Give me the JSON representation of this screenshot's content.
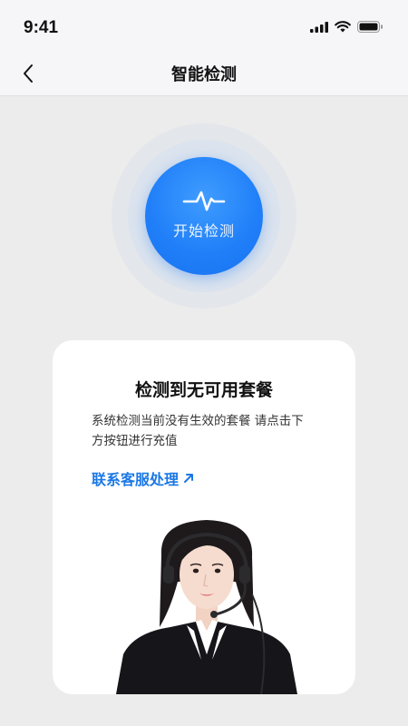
{
  "status_bar": {
    "time": "9:41"
  },
  "nav": {
    "title": "智能检测"
  },
  "start_button": {
    "label": "开始检测"
  },
  "card": {
    "title": "检测到无可用套餐",
    "description": "系统检测当前没有生效的套餐 请点击下方按钮进行充值",
    "contact_link": "联系客服处理"
  },
  "colors": {
    "accent": "#1a78e5",
    "button": "#1f7ef8",
    "background": "#ececec"
  }
}
